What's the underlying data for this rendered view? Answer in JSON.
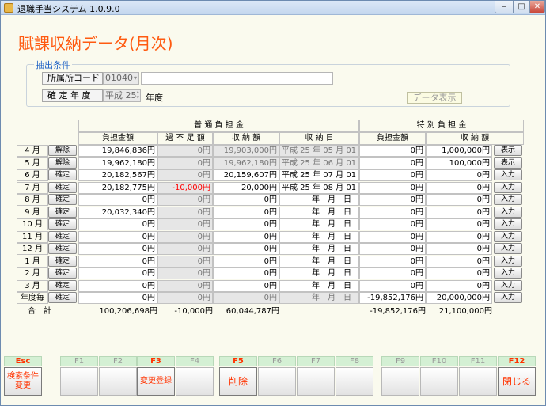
{
  "window": {
    "title": "退職手当システム 1.0.9.0",
    "min": "–",
    "max": "□",
    "close": "✕"
  },
  "page_title": "賦課収納データ(月次)",
  "filter": {
    "group_label": "抽出条件",
    "office_label": "所属所コード",
    "office_code": "01040",
    "year_label": "確 定 年 度",
    "year_value": "平成 25",
    "year_suffix": "年度",
    "show_button": "データ表示"
  },
  "grid": {
    "header_normal": "普 通 負 担 金",
    "header_special": "特 別 負 担 金",
    "cols": [
      "負担金額",
      "過 不 足 額",
      "収 納 額",
      "収 納 日",
      "負担金額",
      "収 納 額"
    ],
    "rows": [
      {
        "month": "4 月",
        "btn": "解除",
        "burden": "19,846,836円",
        "diff": "0円",
        "received": "19,903,000円",
        "date": "平成 25 年 05 月 01 日",
        "sp_burden": "0円",
        "sp_received": "1,000,000円",
        "act": "表示",
        "locked": true
      },
      {
        "month": "5 月",
        "btn": "解除",
        "burden": "19,962,180円",
        "diff": "0円",
        "received": "19,962,180円",
        "date": "平成 25 年 06 月 01 日",
        "sp_burden": "0円",
        "sp_received": "100,000円",
        "act": "表示",
        "locked": true
      },
      {
        "month": "6 月",
        "btn": "確定",
        "burden": "20,182,567円",
        "diff": "0円",
        "received": "20,159,607円",
        "date": "平成 25 年 07 月 01 日",
        "sp_burden": "0円",
        "sp_received": "0円",
        "act": "入力",
        "locked": false
      },
      {
        "month": "7 月",
        "btn": "確定",
        "burden": "20,182,775円",
        "diff": "-10,000円",
        "received": "20,000円",
        "date": "平成 25 年 08 月 01 日",
        "sp_burden": "0円",
        "sp_received": "0円",
        "act": "入力",
        "locked": false,
        "red": true
      },
      {
        "month": "8 月",
        "btn": "確定",
        "burden": "0円",
        "diff": "0円",
        "received": "0円",
        "date": "",
        "sp_burden": "0円",
        "sp_received": "0円",
        "act": "入力",
        "locked": false
      },
      {
        "month": "9 月",
        "btn": "確定",
        "burden": "20,032,340円",
        "diff": "0円",
        "received": "0円",
        "date": "",
        "sp_burden": "0円",
        "sp_received": "0円",
        "act": "入力",
        "locked": false
      },
      {
        "month": "10 月",
        "btn": "確定",
        "burden": "0円",
        "diff": "0円",
        "received": "0円",
        "date": "",
        "sp_burden": "0円",
        "sp_received": "0円",
        "act": "入力",
        "locked": false
      },
      {
        "month": "11 月",
        "btn": "確定",
        "burden": "0円",
        "diff": "0円",
        "received": "0円",
        "date": "",
        "sp_burden": "0円",
        "sp_received": "0円",
        "act": "入力",
        "locked": false
      },
      {
        "month": "12 月",
        "btn": "確定",
        "burden": "0円",
        "diff": "0円",
        "received": "0円",
        "date": "",
        "sp_burden": "0円",
        "sp_received": "0円",
        "act": "入力",
        "locked": false
      },
      {
        "month": "1 月",
        "btn": "確定",
        "burden": "0円",
        "diff": "0円",
        "received": "0円",
        "date": "",
        "sp_burden": "0円",
        "sp_received": "0円",
        "act": "入力",
        "locked": false
      },
      {
        "month": "2 月",
        "btn": "確定",
        "burden": "0円",
        "diff": "0円",
        "received": "0円",
        "date": "",
        "sp_burden": "0円",
        "sp_received": "0円",
        "act": "入力",
        "locked": false
      },
      {
        "month": "3 月",
        "btn": "確定",
        "burden": "0円",
        "diff": "0円",
        "received": "0円",
        "date": "",
        "sp_burden": "0円",
        "sp_received": "0円",
        "act": "入力",
        "locked": false
      },
      {
        "month": "年度毎",
        "btn": "確定",
        "burden": "0円",
        "diff": "0円",
        "received": "0円",
        "date": "",
        "sp_burden": "-19,852,176円",
        "sp_received": "20,000,000円",
        "act": "入力",
        "locked": false,
        "yearly": true
      }
    ],
    "empty_date": "年　月　日",
    "total": {
      "label": "合　計",
      "burden": "100,206,698円",
      "diff": "-10,000円",
      "received": "60,044,787円",
      "sp_burden": "-19,852,176円",
      "sp_received": "21,100,000円"
    }
  },
  "fkeys": [
    {
      "key": "Esc",
      "label": "検索条件変更",
      "on": true
    },
    {
      "key": "F1",
      "label": "",
      "on": false
    },
    {
      "key": "F2",
      "label": "",
      "on": false
    },
    {
      "key": "F3",
      "label": "変更登録",
      "on": true
    },
    {
      "key": "F4",
      "label": "",
      "on": false
    },
    {
      "key": "F5",
      "label": "削除",
      "on": true
    },
    {
      "key": "F6",
      "label": "",
      "on": false
    },
    {
      "key": "F7",
      "label": "",
      "on": false
    },
    {
      "key": "F8",
      "label": "",
      "on": false
    },
    {
      "key": "F9",
      "label": "",
      "on": false
    },
    {
      "key": "F10",
      "label": "",
      "on": false
    },
    {
      "key": "F11",
      "label": "",
      "on": false
    },
    {
      "key": "F12",
      "label": "閉じる",
      "on": true
    }
  ]
}
